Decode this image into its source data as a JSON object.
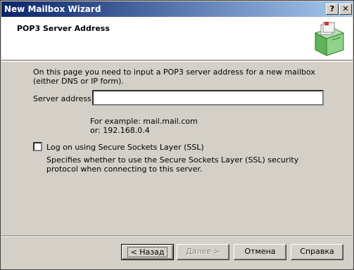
{
  "window": {
    "title": "New Mailbox Wizard",
    "help_label": "?",
    "close_label": "✕"
  },
  "header": {
    "title": "POP3 Server Address"
  },
  "content": {
    "intro": "On this page you need to input a POP3 server address for a new mailbox (either DNS or IP form).",
    "server_label": "Server address:",
    "server_value": "",
    "example_line1": "For example: mail.mail.com",
    "example_line2": "or: 192.168.0.4",
    "ssl_label": "Log on using Secure Sockets Layer (SSL)",
    "ssl_checked": false,
    "ssl_description": "Specifies whether to use the Secure Sockets Layer (SSL) security protocol when connecting to this server."
  },
  "buttons": {
    "back": "< Назад",
    "next": "Далее >",
    "cancel": "Отмена",
    "help": "Справка"
  }
}
